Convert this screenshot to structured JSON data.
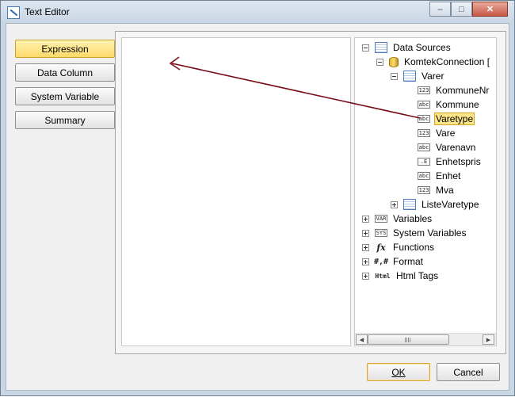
{
  "window": {
    "title": "Text Editor",
    "caption_buttons": {
      "minimize": "–",
      "maximize": "□",
      "close": "✕"
    }
  },
  "left_nav": {
    "buttons": [
      {
        "label": "Expression",
        "active": true
      },
      {
        "label": "Data Column",
        "active": false
      },
      {
        "label": "System Variable",
        "active": false
      },
      {
        "label": "Summary",
        "active": false
      }
    ]
  },
  "editor": {
    "value": ""
  },
  "tree": {
    "data_sources": "Data Sources",
    "connection": "KomtekConnection [",
    "table_varer": "Varer",
    "columns": [
      {
        "label": "KommuneNr",
        "icon": "123",
        "type_icon": "number-column-icon"
      },
      {
        "label": "Kommune",
        "icon": "abc",
        "type_icon": "text-column-icon"
      },
      {
        "label": "Varetype",
        "icon": "abc",
        "type_icon": "text-column-icon",
        "selected": true
      },
      {
        "label": "Vare",
        "icon": "123",
        "type_icon": "number-column-icon"
      },
      {
        "label": "Varenavn",
        "icon": "abc",
        "type_icon": "text-column-icon"
      },
      {
        "label": "Enhetspris",
        "icon": ".E",
        "type_icon": "decimal-column-icon"
      },
      {
        "label": "Enhet",
        "icon": "abc",
        "type_icon": "text-column-icon"
      },
      {
        "label": "Mva",
        "icon": "123",
        "type_icon": "number-column-icon"
      }
    ],
    "table_listevaretype": "ListeVaretype",
    "roots": [
      {
        "label": "Variables",
        "icon": "VAR"
      },
      {
        "label": "System Variables",
        "icon": "SYS"
      },
      {
        "label": "Functions",
        "icon": "fx"
      },
      {
        "label": "Format",
        "icon": "#,#"
      },
      {
        "label": "Html Tags",
        "icon": "Html"
      }
    ]
  },
  "buttons": {
    "ok": "OK",
    "cancel": "Cancel"
  },
  "colors": {
    "arrow": "#7a0f1a",
    "active_button": "#fdd96a",
    "selection": "#fde68a"
  }
}
